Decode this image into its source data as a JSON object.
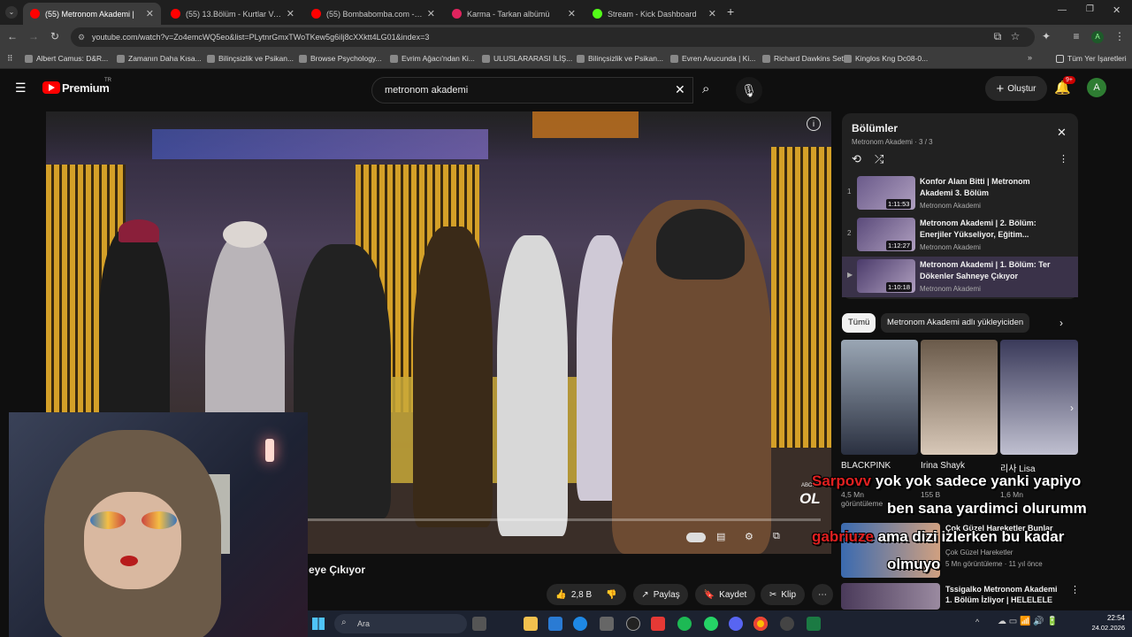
{
  "browser": {
    "tabs": [
      {
        "label": "(55) Metronom Akademi |",
        "active": true,
        "color": "#ff0000"
      },
      {
        "label": "(55) 13.Bölüm - Kurtlar Vadisi |",
        "active": false,
        "color": "#ff0000"
      },
      {
        "label": "(55) Bombabomba.com - YouT",
        "active": false,
        "color": "#ff0000"
      },
      {
        "label": "Karma - Tarkan albümü",
        "active": false,
        "color": "#e0245e"
      },
      {
        "label": "Stream - Kick Dashboard",
        "active": false,
        "color": "#53fc18"
      }
    ],
    "url": "youtube.com/watch?v=Zo4emcWQ5eo&list=PLytnrGmxTWoTKew5g6iIj8cXXktt4LG01&index=3",
    "bookmarks": [
      "Albert Camus: D&R...",
      "Zamanın Daha Kısa...",
      "Bilinçsizlik ve Psikan...",
      "Browse Psychology...",
      "Evrim Ağacı'ndan Ki...",
      "ULUSLARARASI İLİŞ...",
      "Bilinçsizlik ve Psikan...",
      "Evren Avucunda | Ki...",
      "Richard Dawkins Set...",
      "Kinglos Kng Dc08-0..."
    ],
    "all_bookmarks": "Tüm Yer İşaretleri"
  },
  "youtube": {
    "logo": "Premium",
    "logo_tr": "TR",
    "search_value": "metronom akademi",
    "create": "Oluştur",
    "notif_count": "9+",
    "avatar": "A"
  },
  "video": {
    "title_partial": "eye Çıkıyor",
    "likes": "2,8 B",
    "share": "Paylaş",
    "save": "Kaydet",
    "clip": "Klip",
    "watermark": "OL",
    "watermark_small": "ABONE"
  },
  "playlist": {
    "title": "Bölümler",
    "subtitle": "Metronom Akademi · 3 / 3",
    "items": [
      {
        "num": "1",
        "title": "Konfor Alanı Bitti | Metronom Akademi 3. Bölüm",
        "channel": "Metronom Akademi",
        "duration": "1:11:53"
      },
      {
        "num": "2",
        "title": "Metronom Akademi | 2. Bölüm: Enerjiler Yükseliyor, Eğitim...",
        "channel": "Metronom Akademi",
        "duration": "1:12:27"
      },
      {
        "num": "▶",
        "title": "Metronom Akademi | 1. Bölüm: Ter Dökenler Sahneye Çıkıyor",
        "channel": "Metronom Akademi",
        "duration": "1:10:18"
      }
    ]
  },
  "chips": [
    "Tümü",
    "Metronom Akademi adlı yükleyiciden"
  ],
  "shorts": [
    {
      "title": "BLACKPINK",
      "meta": "4,5 Mn görüntüleme"
    },
    {
      "title": "Irina Shayk",
      "meta": "155 B"
    },
    {
      "title": "리사 Lisa",
      "meta": "1,6 Mn"
    }
  ],
  "recs": [
    {
      "title": "Çok Güzel Hareketler Bunlar",
      "channel": "Çok Güzel Hareketler",
      "meta": "5 Mn görüntüleme · 11 yıl önce"
    },
    {
      "title": "Tssigalko Metronom Akademi 1. Bölüm İzliyor | HELELELE ...",
      "channel": "",
      "meta": ""
    }
  ],
  "chat_overlay": [
    {
      "user": "Sarpovv",
      "text": "yok yok sadece yanki yapiyo"
    },
    {
      "user": "",
      "text": "ben sana yardimci olurumm"
    },
    {
      "user": "gabriuze",
      "text": "ama dizi izlerken bu kadar"
    },
    {
      "user": "",
      "text": "olmuyo"
    }
  ],
  "taskbar": {
    "search": "Ara",
    "time": "22:54",
    "date": "24.02.2026"
  }
}
